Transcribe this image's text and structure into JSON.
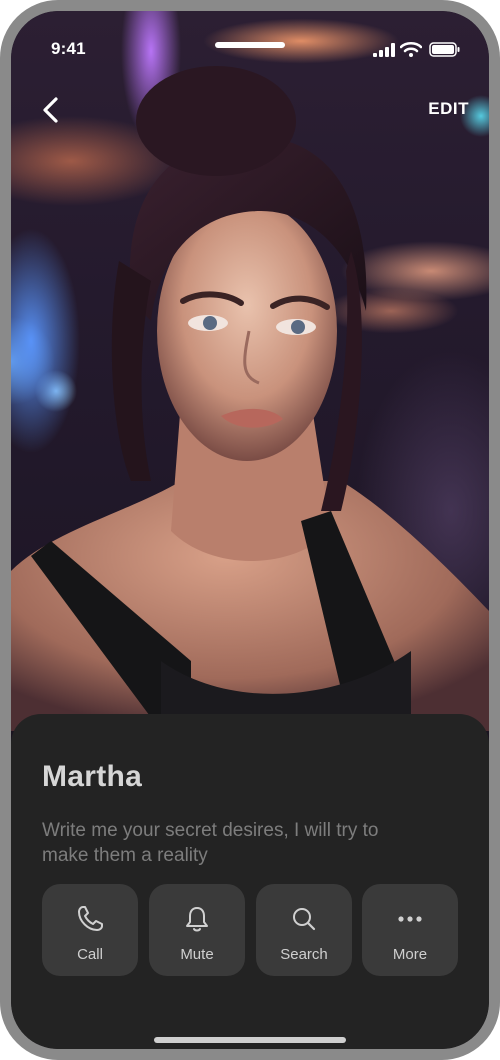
{
  "status_bar": {
    "time": "9:41"
  },
  "nav": {
    "edit_label": "EDIT"
  },
  "profile": {
    "name": "Martha",
    "bio": "Write me your secret desires, I will try to make them a reality"
  },
  "actions": [
    {
      "label": "Call",
      "icon": "phone-icon"
    },
    {
      "label": "Mute",
      "icon": "bell-icon"
    },
    {
      "label": "Search",
      "icon": "search-icon"
    },
    {
      "label": "More",
      "icon": "more-dots-icon"
    }
  ]
}
